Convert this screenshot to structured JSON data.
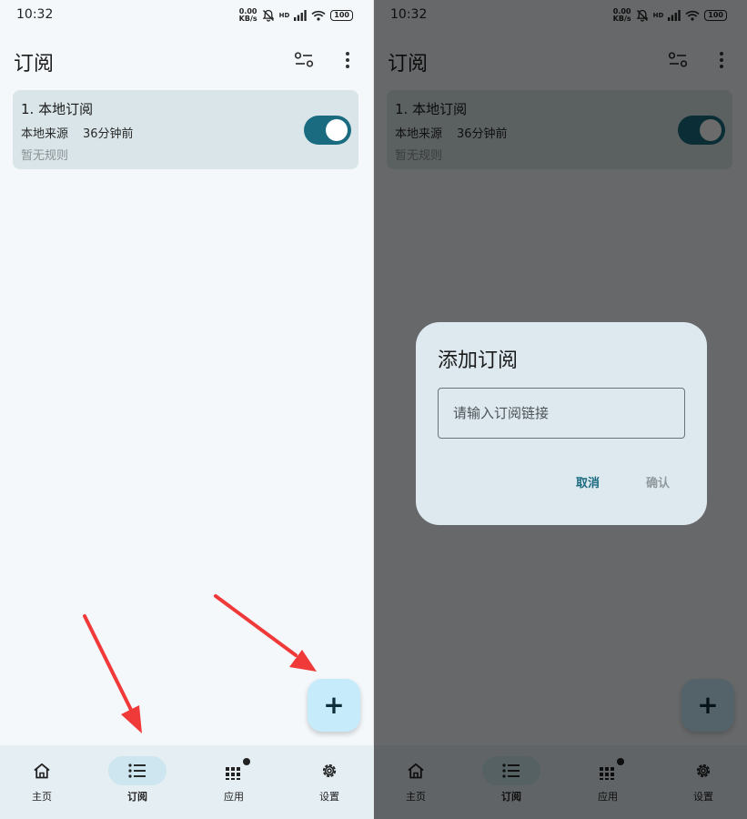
{
  "status": {
    "time": "10:32",
    "net_speed_value": "0.00",
    "net_speed_unit": "KB/s",
    "hd_label": "HD",
    "battery": "100"
  },
  "app_bar": {
    "title": "订阅"
  },
  "subscription": {
    "title": "1. 本地订阅",
    "source": "本地来源",
    "updated": "36分钟前",
    "rules": "暂无规则",
    "enabled": true
  },
  "fab": {
    "icon": "+"
  },
  "bottom_nav": {
    "items": [
      {
        "label": "主页",
        "icon": "home-icon",
        "active": false
      },
      {
        "label": "订阅",
        "icon": "list-icon",
        "active": true
      },
      {
        "label": "应用",
        "icon": "apps-grid-icon",
        "active": false
      },
      {
        "label": "设置",
        "icon": "gear-icon",
        "active": false
      }
    ]
  },
  "dialog": {
    "title": "添加订阅",
    "input_placeholder": "请输入订阅链接",
    "cancel_label": "取消",
    "confirm_label": "确认"
  },
  "colors": {
    "background": "#f4f8fb",
    "card": "#d9e5e8",
    "accent": "#1a6b80",
    "fab": "#c6ebfb",
    "nav": "#e5eef3",
    "nav_active_pill": "#cde6ef",
    "annotation_arrow": "#f03a3a",
    "dialog": "#dde8ef"
  }
}
